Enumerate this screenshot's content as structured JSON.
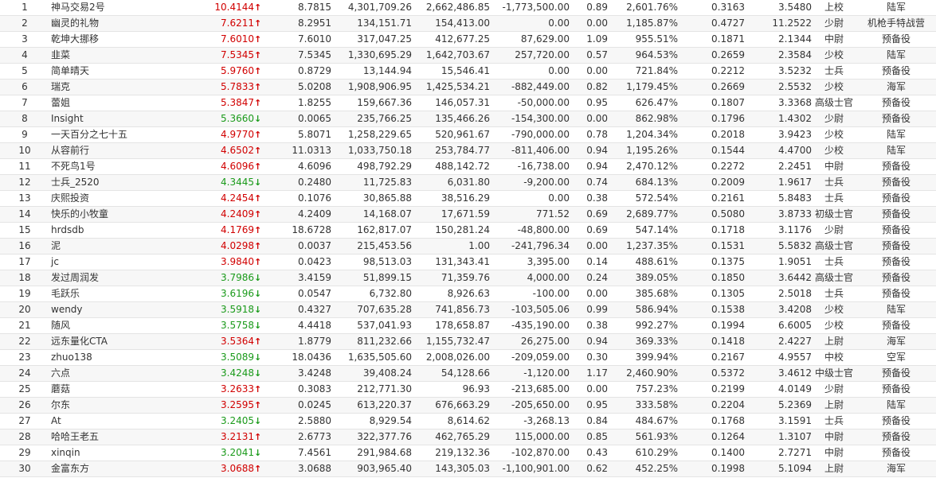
{
  "colors": {
    "up": "#d10000",
    "down": "#1a9a1a"
  },
  "icons": {
    "up": "↑",
    "down": "↓"
  },
  "rows": [
    {
      "rank": "1",
      "name": "神马交易2号",
      "value": "10.4144",
      "trend": "up",
      "c4": "8.7815",
      "c5": "4,301,709.26",
      "c6": "2,662,486.85",
      "c7": "-1,773,500.00",
      "c8": "0.89",
      "c9": "2,601.76%",
      "c10": "0.3163",
      "c11": "3.5480",
      "title": "上校",
      "branch": "陆军"
    },
    {
      "rank": "2",
      "name": "幽灵的礼物",
      "value": "7.6211",
      "trend": "up",
      "c4": "8.2951",
      "c5": "134,151.71",
      "c6": "154,413.00",
      "c7": "0.00",
      "c8": "0.00",
      "c9": "1,185.87%",
      "c10": "0.4727",
      "c11": "11.2522",
      "title": "少尉",
      "branch": "机枪手特战营"
    },
    {
      "rank": "3",
      "name": "乾坤大挪移",
      "value": "7.6010",
      "trend": "up",
      "c4": "7.6010",
      "c5": "317,047.25",
      "c6": "412,677.25",
      "c7": "87,629.00",
      "c8": "1.09",
      "c9": "955.51%",
      "c10": "0.1871",
      "c11": "2.1344",
      "title": "中尉",
      "branch": "预备役"
    },
    {
      "rank": "4",
      "name": "韭菜",
      "value": "7.5345",
      "trend": "up",
      "c4": "7.5345",
      "c5": "1,330,695.29",
      "c6": "1,642,703.67",
      "c7": "257,720.00",
      "c8": "0.57",
      "c9": "964.53%",
      "c10": "0.2659",
      "c11": "2.3584",
      "title": "少校",
      "branch": "陆军"
    },
    {
      "rank": "5",
      "name": "简单晴天",
      "value": "5.9760",
      "trend": "up",
      "c4": "0.8729",
      "c5": "13,144.94",
      "c6": "15,546.41",
      "c7": "0.00",
      "c8": "0.00",
      "c9": "721.84%",
      "c10": "0.2212",
      "c11": "3.5232",
      "title": "士兵",
      "branch": "预备役"
    },
    {
      "rank": "6",
      "name": "瑞克",
      "value": "5.7833",
      "trend": "up",
      "c4": "5.0208",
      "c5": "1,908,906.95",
      "c6": "1,425,534.21",
      "c7": "-882,449.00",
      "c8": "0.82",
      "c9": "1,179.45%",
      "c10": "0.2669",
      "c11": "2.5532",
      "title": "少校",
      "branch": "海军"
    },
    {
      "rank": "7",
      "name": "蕾姐",
      "value": "5.3847",
      "trend": "up",
      "c4": "1.8255",
      "c5": "159,667.36",
      "c6": "146,057.31",
      "c7": "-50,000.00",
      "c8": "0.95",
      "c9": "626.47%",
      "c10": "0.1807",
      "c11": "3.3368",
      "title": "高级士官",
      "branch": "预备役"
    },
    {
      "rank": "8",
      "name": "Insight",
      "value": "5.3660",
      "trend": "down",
      "c4": "0.0065",
      "c5": "235,766.25",
      "c6": "135,466.26",
      "c7": "-154,300.00",
      "c8": "0.00",
      "c9": "862.98%",
      "c10": "0.1796",
      "c11": "1.4302",
      "title": "少尉",
      "branch": "预备役"
    },
    {
      "rank": "9",
      "name": "一天百分之七十五",
      "value": "4.9770",
      "trend": "up",
      "c4": "5.8071",
      "c5": "1,258,229.65",
      "c6": "520,961.67",
      "c7": "-790,000.00",
      "c8": "0.78",
      "c9": "1,204.34%",
      "c10": "0.2018",
      "c11": "3.9423",
      "title": "少校",
      "branch": "陆军"
    },
    {
      "rank": "10",
      "name": "从容前行",
      "value": "4.6502",
      "trend": "up",
      "c4": "11.0313",
      "c5": "1,033,750.18",
      "c6": "253,784.77",
      "c7": "-811,406.00",
      "c8": "0.94",
      "c9": "1,195.26%",
      "c10": "0.1544",
      "c11": "4.4700",
      "title": "少校",
      "branch": "陆军"
    },
    {
      "rank": "11",
      "name": "不死鸟1号",
      "value": "4.6096",
      "trend": "up",
      "c4": "4.6096",
      "c5": "498,792.29",
      "c6": "488,142.72",
      "c7": "-16,738.00",
      "c8": "0.94",
      "c9": "2,470.12%",
      "c10": "0.2272",
      "c11": "2.2451",
      "title": "中尉",
      "branch": "预备役"
    },
    {
      "rank": "12",
      "name": "士兵_2520",
      "value": "4.3445",
      "trend": "down",
      "c4": "0.2480",
      "c5": "11,725.83",
      "c6": "6,031.80",
      "c7": "-9,200.00",
      "c8": "0.74",
      "c9": "684.13%",
      "c10": "0.2009",
      "c11": "1.9617",
      "title": "士兵",
      "branch": "预备役"
    },
    {
      "rank": "13",
      "name": "庆熙投资",
      "value": "4.2454",
      "trend": "up",
      "c4": "0.1076",
      "c5": "30,865.88",
      "c6": "38,516.29",
      "c7": "0.00",
      "c8": "0.38",
      "c9": "572.54%",
      "c10": "0.2161",
      "c11": "5.8483",
      "title": "士兵",
      "branch": "预备役"
    },
    {
      "rank": "14",
      "name": "快乐的小牧童",
      "value": "4.2409",
      "trend": "up",
      "c4": "4.2409",
      "c5": "14,168.07",
      "c6": "17,671.59",
      "c7": "771.52",
      "c8": "0.69",
      "c9": "2,689.77%",
      "c10": "0.5080",
      "c11": "3.8733",
      "title": "初级士官",
      "branch": "预备役"
    },
    {
      "rank": "15",
      "name": "hrdsdb",
      "value": "4.1769",
      "trend": "up",
      "c4": "18.6728",
      "c5": "162,817.07",
      "c6": "150,281.24",
      "c7": "-48,800.00",
      "c8": "0.69",
      "c9": "547.14%",
      "c10": "0.1718",
      "c11": "3.1176",
      "title": "少尉",
      "branch": "预备役"
    },
    {
      "rank": "16",
      "name": "泥",
      "value": "4.0298",
      "trend": "up",
      "c4": "0.0037",
      "c5": "215,453.56",
      "c6": "1.00",
      "c7": "-241,796.34",
      "c8": "0.00",
      "c9": "1,237.35%",
      "c10": "0.1531",
      "c11": "5.5832",
      "title": "高级士官",
      "branch": "预备役"
    },
    {
      "rank": "17",
      "name": "jc",
      "value": "3.9840",
      "trend": "up",
      "c4": "0.0423",
      "c5": "98,513.03",
      "c6": "131,343.41",
      "c7": "3,395.00",
      "c8": "0.14",
      "c9": "488.61%",
      "c10": "0.1375",
      "c11": "1.9051",
      "title": "士兵",
      "branch": "预备役"
    },
    {
      "rank": "18",
      "name": "发过周润发",
      "value": "3.7986",
      "trend": "down",
      "c4": "3.4159",
      "c5": "51,899.15",
      "c6": "71,359.76",
      "c7": "4,000.00",
      "c8": "0.24",
      "c9": "389.05%",
      "c10": "0.1850",
      "c11": "3.6442",
      "title": "高级士官",
      "branch": "预备役"
    },
    {
      "rank": "19",
      "name": "毛跃乐",
      "value": "3.6196",
      "trend": "down",
      "c4": "0.0547",
      "c5": "6,732.80",
      "c6": "8,926.63",
      "c7": "-100.00",
      "c8": "0.00",
      "c9": "385.68%",
      "c10": "0.1305",
      "c11": "2.5018",
      "title": "士兵",
      "branch": "预备役"
    },
    {
      "rank": "20",
      "name": "wendy",
      "value": "3.5918",
      "trend": "down",
      "c4": "0.4327",
      "c5": "707,635.28",
      "c6": "741,856.73",
      "c7": "-103,505.06",
      "c8": "0.99",
      "c9": "586.94%",
      "c10": "0.1538",
      "c11": "3.4208",
      "title": "少校",
      "branch": "陆军"
    },
    {
      "rank": "21",
      "name": "随风",
      "value": "3.5758",
      "trend": "down",
      "c4": "4.4418",
      "c5": "537,041.93",
      "c6": "178,658.87",
      "c7": "-435,190.00",
      "c8": "0.38",
      "c9": "992.27%",
      "c10": "0.1994",
      "c11": "6.6005",
      "title": "少校",
      "branch": "预备役"
    },
    {
      "rank": "22",
      "name": "远东量化CTA",
      "value": "3.5364",
      "trend": "up",
      "c4": "1.8779",
      "c5": "811,232.66",
      "c6": "1,155,732.47",
      "c7": "26,275.00",
      "c8": "0.94",
      "c9": "369.33%",
      "c10": "0.1418",
      "c11": "2.4227",
      "title": "上尉",
      "branch": "海军"
    },
    {
      "rank": "23",
      "name": "zhuo138",
      "value": "3.5089",
      "trend": "down",
      "c4": "18.0436",
      "c5": "1,635,505.60",
      "c6": "2,008,026.00",
      "c7": "-209,059.00",
      "c8": "0.30",
      "c9": "399.94%",
      "c10": "0.2167",
      "c11": "4.9557",
      "title": "中校",
      "branch": "空军"
    },
    {
      "rank": "24",
      "name": "六点",
      "value": "3.4248",
      "trend": "down",
      "c4": "3.4248",
      "c5": "39,408.24",
      "c6": "54,128.66",
      "c7": "-1,120.00",
      "c8": "1.17",
      "c9": "2,460.90%",
      "c10": "0.5372",
      "c11": "3.4612",
      "title": "中级士官",
      "branch": "预备役"
    },
    {
      "rank": "25",
      "name": "蘑菇",
      "value": "3.2633",
      "trend": "up",
      "c4": "0.3083",
      "c5": "212,771.30",
      "c6": "96.93",
      "c7": "-213,685.00",
      "c8": "0.00",
      "c9": "757.23%",
      "c10": "0.2199",
      "c11": "4.0149",
      "title": "少尉",
      "branch": "预备役"
    },
    {
      "rank": "26",
      "name": "尔东",
      "value": "3.2595",
      "trend": "up",
      "c4": "0.0245",
      "c5": "613,220.37",
      "c6": "676,663.29",
      "c7": "-205,650.00",
      "c8": "0.95",
      "c9": "333.58%",
      "c10": "0.2204",
      "c11": "5.2369",
      "title": "上尉",
      "branch": "陆军"
    },
    {
      "rank": "27",
      "name": "At",
      "value": "3.2405",
      "trend": "down",
      "c4": "2.5880",
      "c5": "8,929.54",
      "c6": "8,614.62",
      "c7": "-3,268.13",
      "c8": "0.84",
      "c9": "484.67%",
      "c10": "0.1768",
      "c11": "3.1591",
      "title": "士兵",
      "branch": "预备役"
    },
    {
      "rank": "28",
      "name": "哈哈王老五",
      "value": "3.2131",
      "trend": "up",
      "c4": "2.6773",
      "c5": "322,377.76",
      "c6": "462,765.29",
      "c7": "115,000.00",
      "c8": "0.85",
      "c9": "561.93%",
      "c10": "0.1264",
      "c11": "1.3107",
      "title": "中尉",
      "branch": "预备役"
    },
    {
      "rank": "29",
      "name": "xinqin",
      "value": "3.2041",
      "trend": "down",
      "c4": "7.4561",
      "c5": "291,984.68",
      "c6": "219,132.36",
      "c7": "-102,870.00",
      "c8": "0.43",
      "c9": "610.29%",
      "c10": "0.1400",
      "c11": "2.7271",
      "title": "中尉",
      "branch": "预备役"
    },
    {
      "rank": "30",
      "name": "金富东方",
      "value": "3.0688",
      "trend": "up",
      "c4": "3.0688",
      "c5": "903,965.40",
      "c6": "143,305.03",
      "c7": "-1,100,901.00",
      "c8": "0.62",
      "c9": "452.25%",
      "c10": "0.1998",
      "c11": "5.1094",
      "title": "上尉",
      "branch": "海军"
    }
  ]
}
